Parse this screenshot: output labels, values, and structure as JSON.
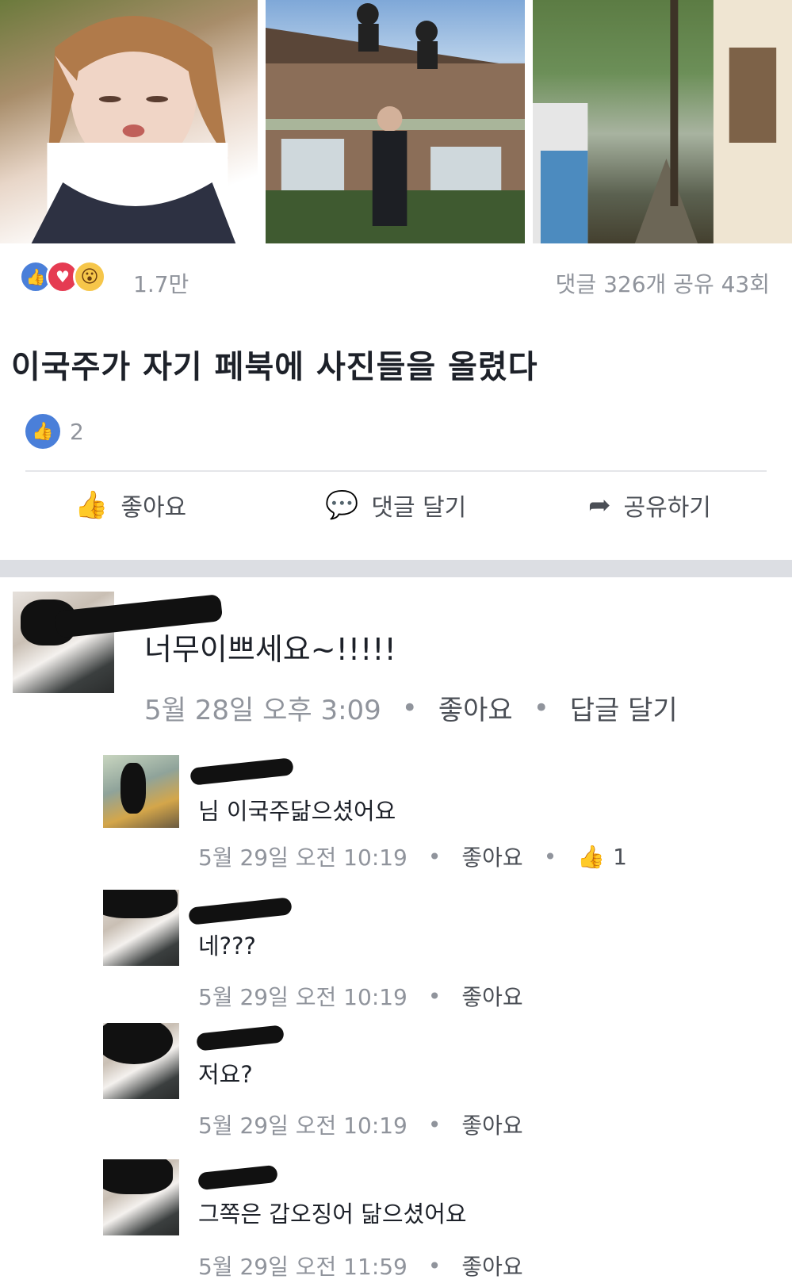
{
  "photos": [
    {
      "alt_name": "selfie-photo"
    },
    {
      "alt_name": "house-rooftop-photo"
    },
    {
      "alt_name": "alley-trees-photo"
    }
  ],
  "reactions": {
    "count": "1.7만",
    "comments_shares": "댓글 326개 공유 43회",
    "icons": [
      "like-icon",
      "love-icon",
      "wow-icon"
    ]
  },
  "post": {
    "text": "이국주가 자기 페북에 사진들을 올렸다",
    "like_count": "2"
  },
  "actions": {
    "like": "좋아요",
    "comment": "댓글 달기",
    "share": "공유하기"
  },
  "comments": [
    {
      "text": "너무이쁘세요~!!!!!",
      "time": "5월 28일 오후 3:09",
      "like": "좋아요",
      "reply": "답글 달기"
    }
  ],
  "replies": [
    {
      "text": "님 이국주닮으셨어요",
      "time": "5월 29일 오전 10:19",
      "like": "좋아요",
      "like_count": "1"
    },
    {
      "text": "네???",
      "time": "5월 29일 오전 10:19",
      "like": "좋아요"
    },
    {
      "text": "저요?",
      "time": "5월 29일 오전 10:19",
      "like": "좋아요"
    },
    {
      "text": "그쪽은 갑오징어 닮으셨어요",
      "time": "5월 29일 오전 11:59",
      "like": "좋아요"
    }
  ],
  "colors": {
    "facebook_blue": "#4a7fd9",
    "love_red": "#e53b52",
    "wow_yellow": "#f6c64a",
    "meta_gray": "#90949c"
  }
}
